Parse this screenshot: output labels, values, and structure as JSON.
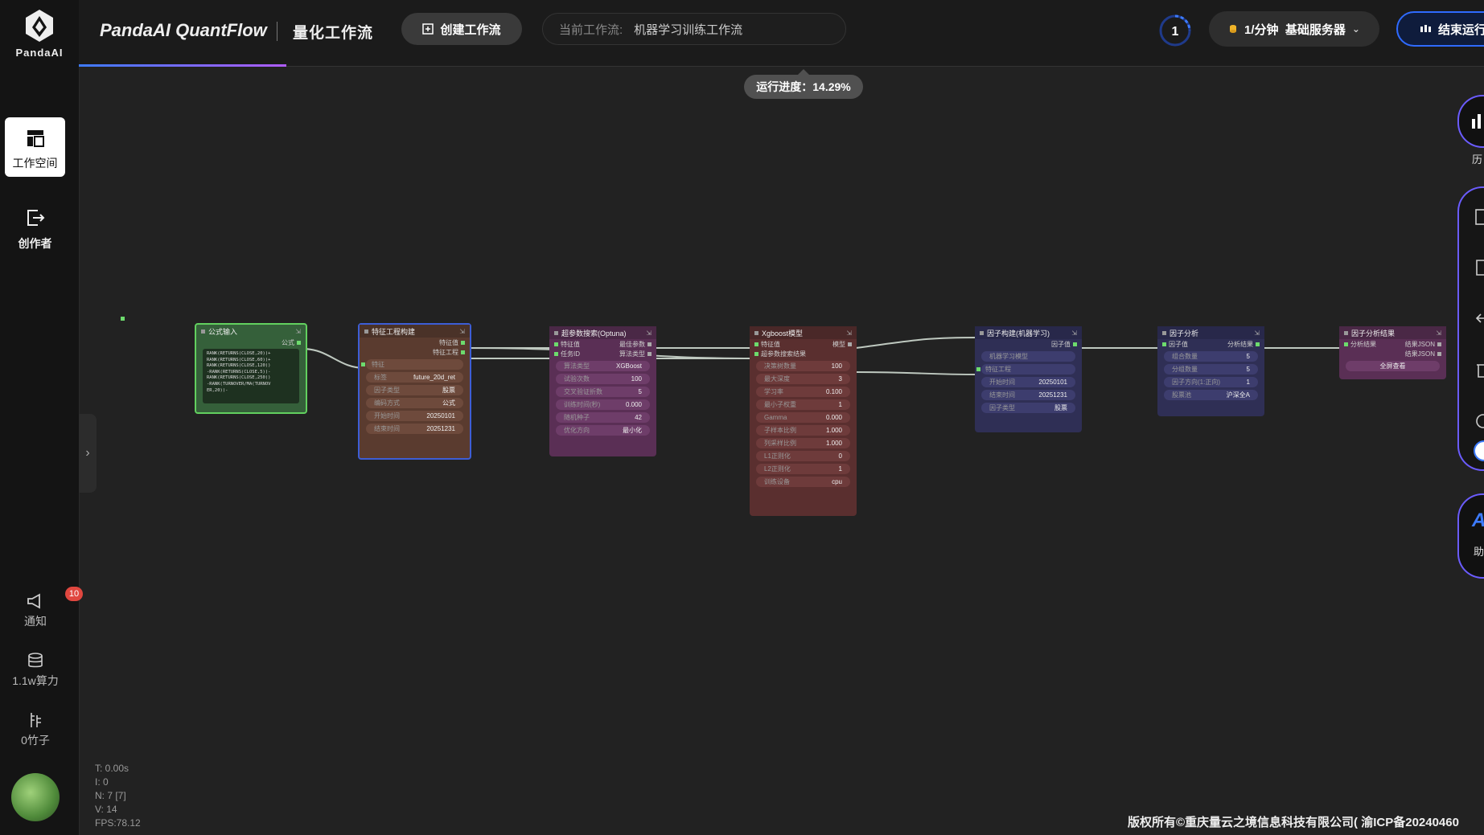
{
  "brand": {
    "logo_text": "PandaAI",
    "name": "PandaAI QuantFlow",
    "subtitle": "量化工作流"
  },
  "sidebar": {
    "nav": [
      {
        "label": "工作空间",
        "icon": "layout-icon",
        "active": true
      },
      {
        "label": "创作者",
        "icon": "export-icon",
        "active": false
      }
    ],
    "notify": {
      "label": "通知",
      "badge": "10",
      "icon": "megaphone-icon"
    },
    "compute": {
      "label": "1.1w算力",
      "icon": "database-icon"
    },
    "bamboo": {
      "label": "0竹子",
      "icon": "bamboo-icon"
    }
  },
  "header": {
    "create_label": "创建工作流",
    "current_key": "当前工作流:",
    "current_value": "机器学习训练工作流",
    "run_count": "1",
    "server_label": "1/分钟  基础服务器",
    "end_label": "结束运行"
  },
  "progress": {
    "text": "运行进度：14.29%",
    "value": 14.29
  },
  "right_panel": {
    "top_label": "历",
    "bottom_label": "助"
  },
  "nodes": {
    "formula": {
      "title": "公式输入",
      "out_label": "公式",
      "lines": [
        "RANK(RETURNS(CLOSE,20))+",
        "RANK(RETURNS(CLOSE,60))+",
        "RANK(RETURNS(CLOSE,120))",
        "-RANK(RETURNS(CLOSE,5))-",
        "RANK(RETURNS(CLOSE,250))",
        "-RANK(TURNOVER/MA(TURNOV",
        "ER,20))-"
      ]
    },
    "feature": {
      "title": "特征工程构建",
      "outs": [
        "特征值",
        "特征工程"
      ],
      "in_label": "特征",
      "widgets": [
        {
          "k": "标签",
          "v": "future_20d_ret"
        },
        {
          "k": "因子类型",
          "v": "股票"
        },
        {
          "k": "编码方式",
          "v": "公式"
        },
        {
          "k": "开始时间",
          "v": "20250101"
        },
        {
          "k": "结束时间",
          "v": "20251231"
        }
      ]
    },
    "optuna": {
      "title": "超参数搜索(Optuna)",
      "ins": [
        "特征值",
        "任务ID"
      ],
      "outs": [
        "最佳参数",
        "算法类型"
      ],
      "widgets": [
        {
          "k": "算法类型",
          "v": "XGBoost"
        },
        {
          "k": "试验次数",
          "v": "100"
        },
        {
          "k": "交叉验证折数",
          "v": "5"
        },
        {
          "k": "训练时间(秒)",
          "v": "0.000"
        },
        {
          "k": "随机种子",
          "v": "42"
        },
        {
          "k": "优化方向",
          "v": "最小化"
        }
      ]
    },
    "xgboost": {
      "title": "Xgboost模型",
      "ins": [
        "特征值",
        "超参数搜索结果"
      ],
      "out_label": "模型",
      "widgets": [
        {
          "k": "决策树数量",
          "v": "100"
        },
        {
          "k": "最大深度",
          "v": "3"
        },
        {
          "k": "学习率",
          "v": "0.100"
        },
        {
          "k": "最小子权重",
          "v": "1"
        },
        {
          "k": "Gamma",
          "v": "0.000"
        },
        {
          "k": "子样本比例",
          "v": "1.000"
        },
        {
          "k": "列采样比例",
          "v": "1.000"
        },
        {
          "k": "L1正则化",
          "v": "0"
        },
        {
          "k": "L2正则化",
          "v": "1"
        },
        {
          "k": "训练设备",
          "v": "cpu"
        }
      ]
    },
    "factor_build": {
      "title": "因子构建(机器学习)",
      "out_label": "因子值",
      "in_label": "特征工程",
      "widgets": [
        {
          "k": "机器学习模型",
          "v": ""
        },
        {
          "k": "特征工程",
          "v": ""
        },
        {
          "k": "开始时间",
          "v": "20250101"
        },
        {
          "k": "结束时间",
          "v": "20251231"
        },
        {
          "k": "因子类型",
          "v": "股票"
        }
      ]
    },
    "factor_analysis": {
      "title": "因子分析",
      "in_label": "因子值",
      "out_label": "分析结果",
      "widgets": [
        {
          "k": "组合数量",
          "v": "5"
        },
        {
          "k": "分组数量",
          "v": "5"
        },
        {
          "k": "因子方向(1:正向)",
          "v": "1"
        },
        {
          "k": "股票池",
          "v": "沪深全A"
        }
      ]
    },
    "factor_result": {
      "title": "因子分析结果",
      "in_label": "分析结果",
      "outs": [
        "结果JSON",
        "结果JSON"
      ],
      "button": "全屏查看"
    }
  },
  "stats": [
    "T: 0.00s",
    "I: 0",
    "N: 7 [7]",
    "V: 14",
    "FPS:78.12"
  ],
  "copyright": "版权所有©重庆量云之境信息科技有限公司( 渝ICP备20240460",
  "colors": {
    "formula_node": "#35603a",
    "feature_node": "#5a3b2f",
    "optuna_node": "#5a2f55",
    "xgboost_node": "#5a2f2f",
    "factor_node": "#2f2f55",
    "accent": "#2f6bff"
  }
}
